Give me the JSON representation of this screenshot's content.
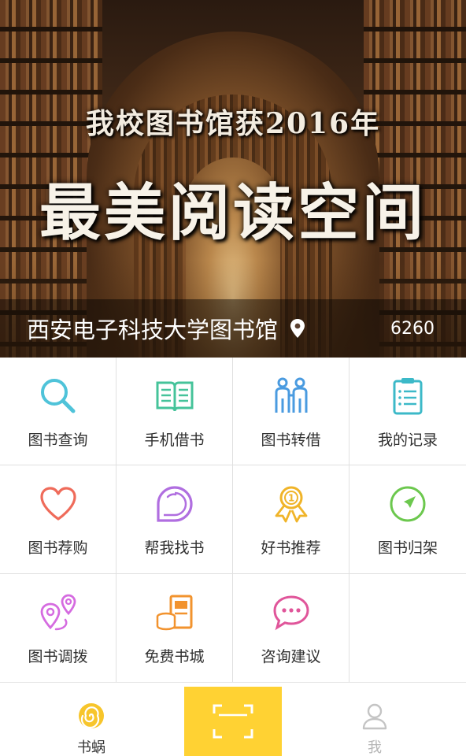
{
  "banner": {
    "subtitle": "我校图书馆获2016年",
    "headline": "最美阅读空间",
    "library_name": "西安电子科技大学图书馆",
    "visit_count": "6260",
    "location_icon": "location-pin-icon"
  },
  "features": [
    {
      "label": "图书查询",
      "icon": "search-icon",
      "color": "#4fc3d9"
    },
    {
      "label": "手机借书",
      "icon": "open-book-icon",
      "color": "#45c39a"
    },
    {
      "label": "图书转借",
      "icon": "two-people-icon",
      "color": "#4a9be0"
    },
    {
      "label": "我的记录",
      "icon": "clipboard-icon",
      "color": "#3cb9c8"
    },
    {
      "label": "图书荐购",
      "icon": "heart-icon",
      "color": "#ef6b5a"
    },
    {
      "label": "帮我找书",
      "icon": "round-tag-icon",
      "color": "#b06ee0"
    },
    {
      "label": "好书推荐",
      "icon": "medal-icon",
      "color": "#f0b429"
    },
    {
      "label": "图书归架",
      "icon": "compass-arrow-icon",
      "color": "#6cc84e"
    },
    {
      "label": "图书调拨",
      "icon": "map-pins-icon",
      "color": "#d56be0"
    },
    {
      "label": "免费书城",
      "icon": "book-coins-icon",
      "color": "#f2932e"
    },
    {
      "label": "咨询建议",
      "icon": "chat-bubble-icon",
      "color": "#e0559a"
    }
  ],
  "tabbar": {
    "snail_label": "书蜗",
    "me_label": "我",
    "scan_icon": "scan-frame-icon",
    "accent": "#ffd233"
  }
}
